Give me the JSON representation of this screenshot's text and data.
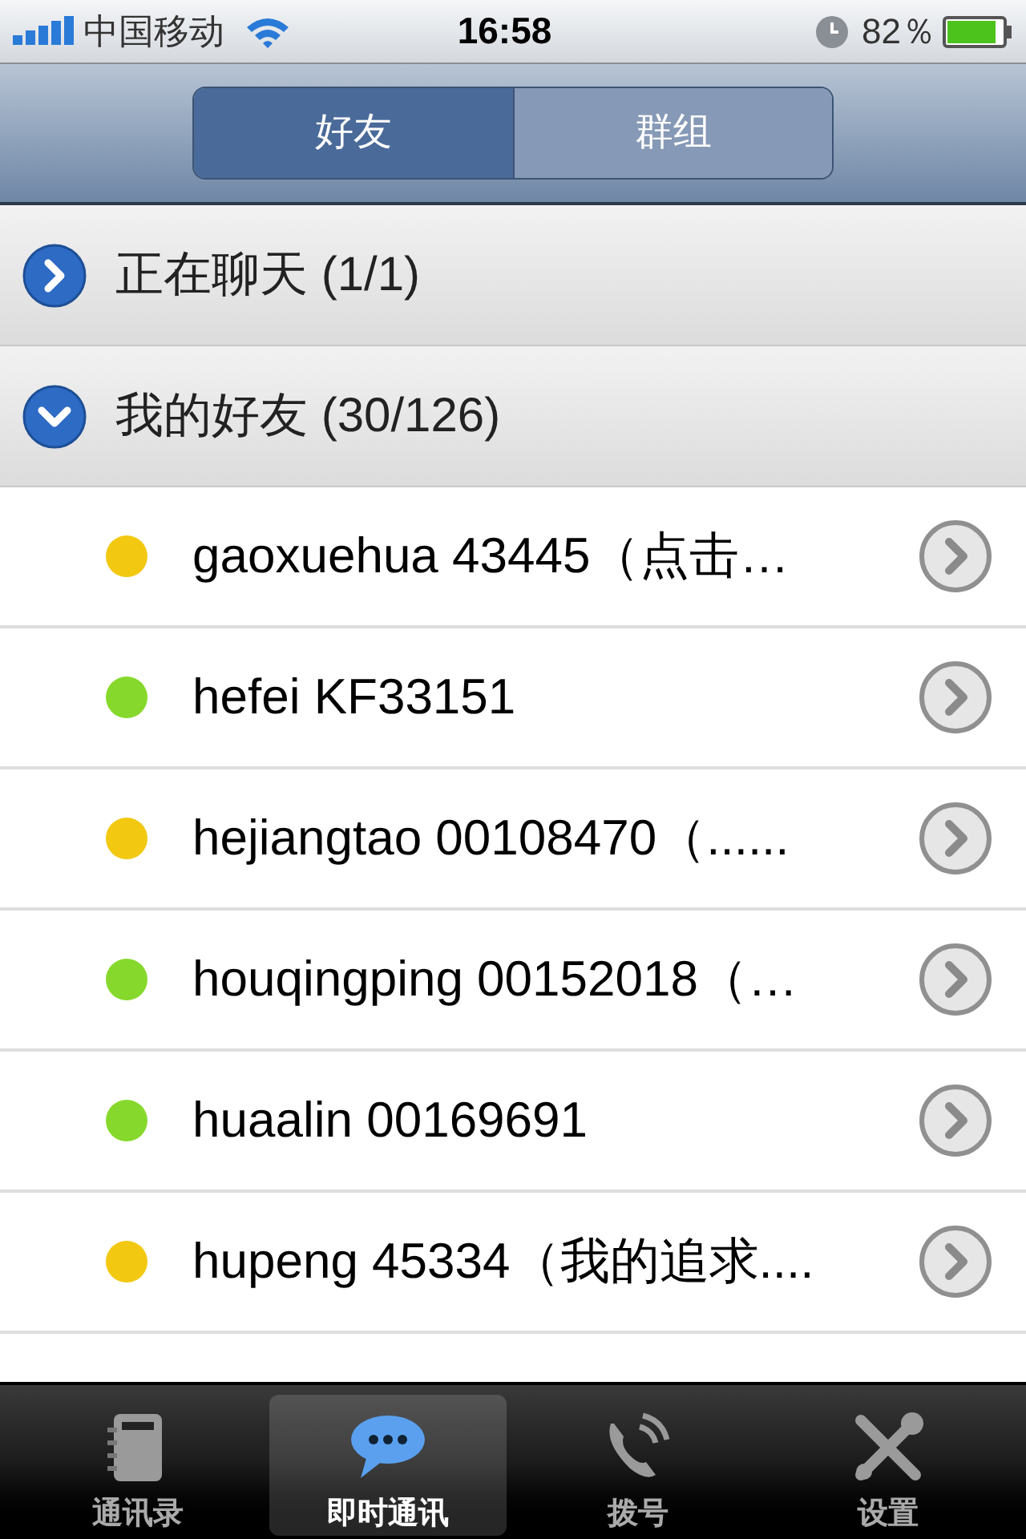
{
  "status_bar": {
    "carrier": "中国移动",
    "time": "16:58",
    "battery": "82％"
  },
  "segments": [
    {
      "label": "好友",
      "selected": true
    },
    {
      "label": "群组",
      "selected": false
    }
  ],
  "sections": [
    {
      "title": "正在聊天 (1/1)",
      "expanded": false
    },
    {
      "title": "我的好友 (30/126)",
      "expanded": true
    }
  ],
  "contacts": [
    {
      "name": "gaoxuehua 43445（点击…",
      "color": "#f2c811"
    },
    {
      "name": "hefei KF33151",
      "color": "#86d92c"
    },
    {
      "name": "hejiangtao 00108470（......",
      "color": "#f2c811"
    },
    {
      "name": "houqingping 00152018（…",
      "color": "#86d92c"
    },
    {
      "name": "huaalin 00169691",
      "color": "#86d92c"
    },
    {
      "name": "hupeng 45334（我的追求....",
      "color": "#f2c811"
    }
  ],
  "tab_bar": [
    {
      "label": "通讯录",
      "kind": "book",
      "selected": false
    },
    {
      "label": "即时通讯",
      "kind": "chat",
      "selected": true
    },
    {
      "label": "拨号",
      "kind": "phone",
      "selected": false
    },
    {
      "label": "设置",
      "kind": "tools",
      "selected": false
    }
  ]
}
